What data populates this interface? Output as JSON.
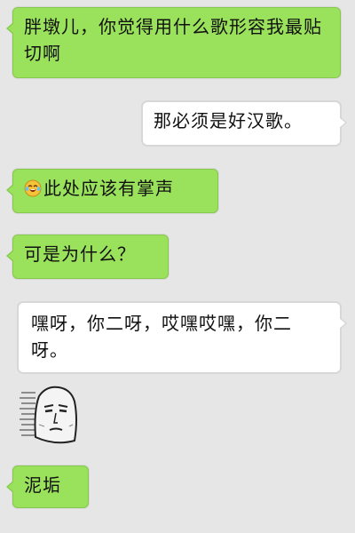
{
  "conversation": {
    "messages": [
      {
        "side": "left",
        "color": "green",
        "text": "胖墩儿，你觉得用什么歌形容我最贴切啊"
      },
      {
        "side": "right",
        "color": "white",
        "text": "那必须是好汉歌。"
      },
      {
        "side": "left",
        "color": "green",
        "emoji_icon": "crying-laughing-face-icon",
        "text": "此处应该有掌声"
      },
      {
        "side": "left",
        "color": "green",
        "text": "可是为什么？"
      },
      {
        "side": "right",
        "color": "white",
        "text": "嘿呀，你二呀，哎嘿哎嘿，你二呀。"
      },
      {
        "side": "left",
        "type": "sticker",
        "sticker_icon": "deadpan-face-sticker-icon"
      },
      {
        "side": "left",
        "color": "green",
        "text": "泥垢"
      }
    ]
  },
  "colors": {
    "background": "#e6e6e6",
    "green_bubble": "#9be25c",
    "white_bubble": "#ffffff"
  }
}
